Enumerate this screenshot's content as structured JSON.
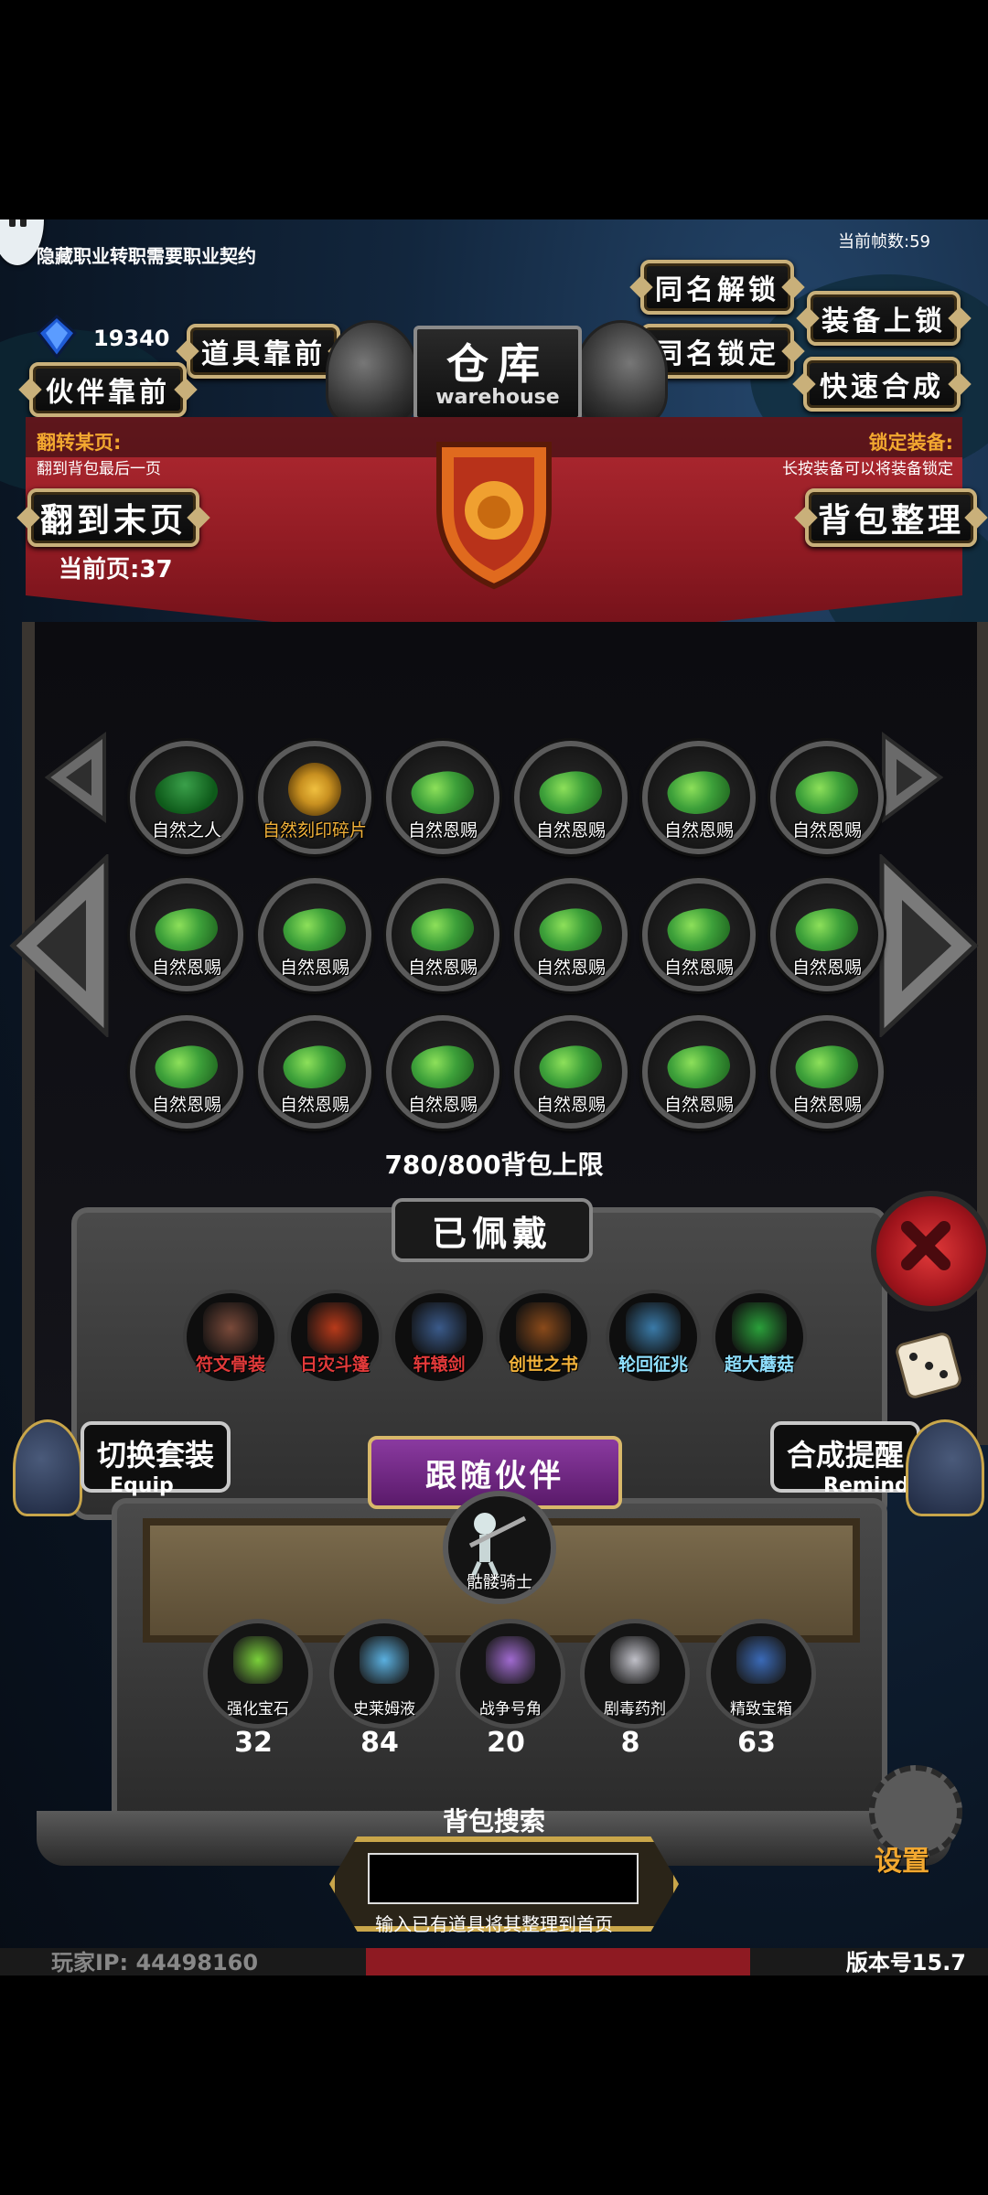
{
  "top_notice": "隐藏职业转职需要职业契约",
  "fps_label": "当前帧数:59",
  "currency": {
    "icon": "blue-gem-icon",
    "amount": "19340"
  },
  "buttons": {
    "item_front": "道具靠前",
    "partner_front": "伙伴靠前",
    "same_name_unlock": "同名解锁",
    "same_name_lock": "同名锁定",
    "equip_lock": "装备上锁",
    "quick_synth": "快速合成",
    "go_last_page": "翻到末页",
    "sort_bag": "背包整理"
  },
  "warehouse": {
    "title": "仓库",
    "subtitle": "warehouse"
  },
  "flip_page": {
    "label": "翻转某页:",
    "desc": "翻到背包最后一页"
  },
  "lock_equip": {
    "label": "锁定装备:",
    "desc": "长按装备可以将装备锁定"
  },
  "current_page": "当前页:37",
  "grid": [
    {
      "name": "自然之人",
      "icon": "nature-man-icon",
      "color": "#ffffff"
    },
    {
      "name": "自然刻印碎片",
      "icon": "engraving-fragment-icon",
      "color": "#f2b23a"
    },
    {
      "name": "自然恩赐",
      "icon": "nature-gift-icon",
      "color": "#ffffff"
    },
    {
      "name": "自然恩赐",
      "icon": "nature-gift-icon",
      "color": "#ffffff"
    },
    {
      "name": "自然恩赐",
      "icon": "nature-gift-icon",
      "color": "#ffffff"
    },
    {
      "name": "自然恩赐",
      "icon": "nature-gift-icon",
      "color": "#ffffff"
    },
    {
      "name": "自然恩赐",
      "icon": "nature-gift-icon",
      "color": "#ffffff"
    },
    {
      "name": "自然恩赐",
      "icon": "nature-gift-icon",
      "color": "#ffffff"
    },
    {
      "name": "自然恩赐",
      "icon": "nature-gift-icon",
      "color": "#ffffff"
    },
    {
      "name": "自然恩赐",
      "icon": "nature-gift-icon",
      "color": "#ffffff"
    },
    {
      "name": "自然恩赐",
      "icon": "nature-gift-icon",
      "color": "#ffffff"
    },
    {
      "name": "自然恩赐",
      "icon": "nature-gift-icon",
      "color": "#ffffff"
    },
    {
      "name": "自然恩赐",
      "icon": "nature-gift-icon",
      "color": "#ffffff"
    },
    {
      "name": "自然恩赐",
      "icon": "nature-gift-icon",
      "color": "#ffffff"
    },
    {
      "name": "自然恩赐",
      "icon": "nature-gift-icon",
      "color": "#ffffff"
    },
    {
      "name": "自然恩赐",
      "icon": "nature-gift-icon",
      "color": "#ffffff"
    },
    {
      "name": "自然恩赐",
      "icon": "nature-gift-icon",
      "color": "#ffffff"
    },
    {
      "name": "自然恩赐",
      "icon": "nature-gift-icon",
      "color": "#ffffff"
    }
  ],
  "capacity": "780/800背包上限",
  "equipped": {
    "title": "已佩戴",
    "items": [
      {
        "name": "符文骨装",
        "icon": "rune-bone-armor-icon",
        "color": "#e23a3a"
      },
      {
        "name": "日灾斗篷",
        "icon": "sun-cloak-icon",
        "color": "#e23a3a"
      },
      {
        "name": "轩辕剑",
        "icon": "sword-icon",
        "color": "#e23a3a"
      },
      {
        "name": "创世之书",
        "icon": "book-icon",
        "color": "#f2b23a"
      },
      {
        "name": "轮回征兆",
        "icon": "ice-staff-icon",
        "color": "#8fe0ff"
      },
      {
        "name": "超大蘑菇",
        "icon": "mushroom-icon",
        "color": "#8fe0ff"
      }
    ]
  },
  "switch_set": {
    "label": "切换套装",
    "sub": "Equip"
  },
  "synth_remind": {
    "label": "合成提醒",
    "sub": "Remind"
  },
  "follow_partner": {
    "title": "跟随伙伴",
    "name": "骷髅骑士",
    "icon": "skeleton-knight-icon"
  },
  "materials": [
    {
      "name": "强化宝石",
      "count": "32",
      "icon": "enhance-gem-icon"
    },
    {
      "name": "史莱姆液",
      "count": "84",
      "icon": "slime-potion-icon"
    },
    {
      "name": "战争号角",
      "count": "20",
      "icon": "war-horn-icon"
    },
    {
      "name": "剧毒药剂",
      "count": "8",
      "icon": "poison-potion-icon"
    },
    {
      "name": "精致宝箱",
      "count": "63",
      "icon": "treasure-chest-icon"
    }
  ],
  "search": {
    "title": "背包搜索",
    "value": "",
    "hint": "输入已有道具将其整理到首页"
  },
  "player_ip": "玩家IP: 44498160",
  "version": "版本号15.7",
  "settings_label": "设置",
  "colors": {
    "gold_frame": "#c9b07a",
    "banner_red": "#a8222c",
    "purple_banner": "#7b2a8a"
  }
}
